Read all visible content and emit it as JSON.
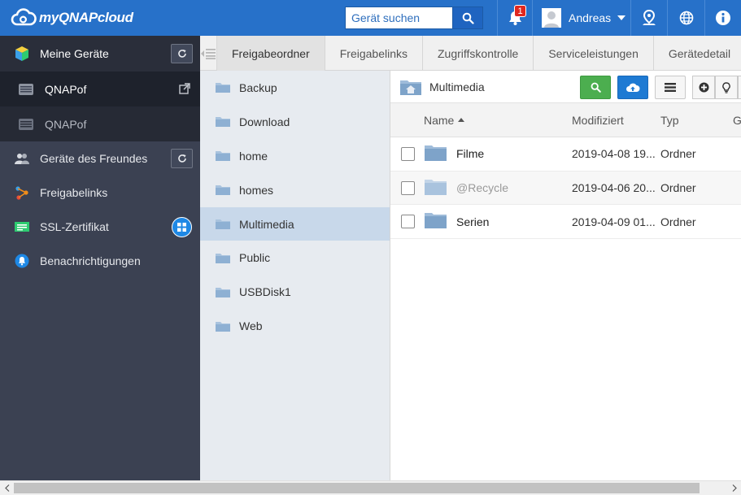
{
  "header": {
    "logo_text": "myQNAPcloud",
    "search_placeholder": "Gerät suchen",
    "notification_count": "1",
    "user_name": "Andreas",
    "accent": "#2771c9"
  },
  "sidebar": {
    "my_devices_label": "Meine Geräte",
    "devices": [
      {
        "name": "QNAPof",
        "state": "active"
      },
      {
        "name": "QNAPof",
        "state": "inactive"
      }
    ],
    "items": [
      {
        "label": "Geräte des Freundes",
        "icon": "friends-icon"
      },
      {
        "label": "Freigabelinks",
        "icon": "share-link-icon"
      },
      {
        "label": "SSL-Zertifikat",
        "icon": "ssl-certificate-icon"
      },
      {
        "label": "Benachrichtigungen",
        "icon": "notification-icon"
      }
    ]
  },
  "tabs": [
    "Freigabeordner",
    "Freigabelinks",
    "Zugriffskontrolle",
    "Serviceleistungen",
    "Gerätedetail"
  ],
  "active_tab": "Freigabeordner",
  "folders": [
    "Backup",
    "Download",
    "home",
    "homes",
    "Multimedia",
    "Public",
    "USBDisk1",
    "Web"
  ],
  "selected_folder": "Multimedia",
  "content": {
    "path_title": "Multimedia",
    "columns": {
      "name": "Name",
      "modified": "Modifiziert",
      "type": "Typ",
      "extra": "G"
    },
    "rows": [
      {
        "name": "Filme",
        "modified": "2019-04-08 19...",
        "type": "Ordner",
        "dim": false
      },
      {
        "name": "@Recycle",
        "modified": "2019-04-06 20...",
        "type": "Ordner",
        "dim": true
      },
      {
        "name": "Serien",
        "modified": "2019-04-09 01...",
        "type": "Ordner",
        "dim": false
      }
    ]
  }
}
